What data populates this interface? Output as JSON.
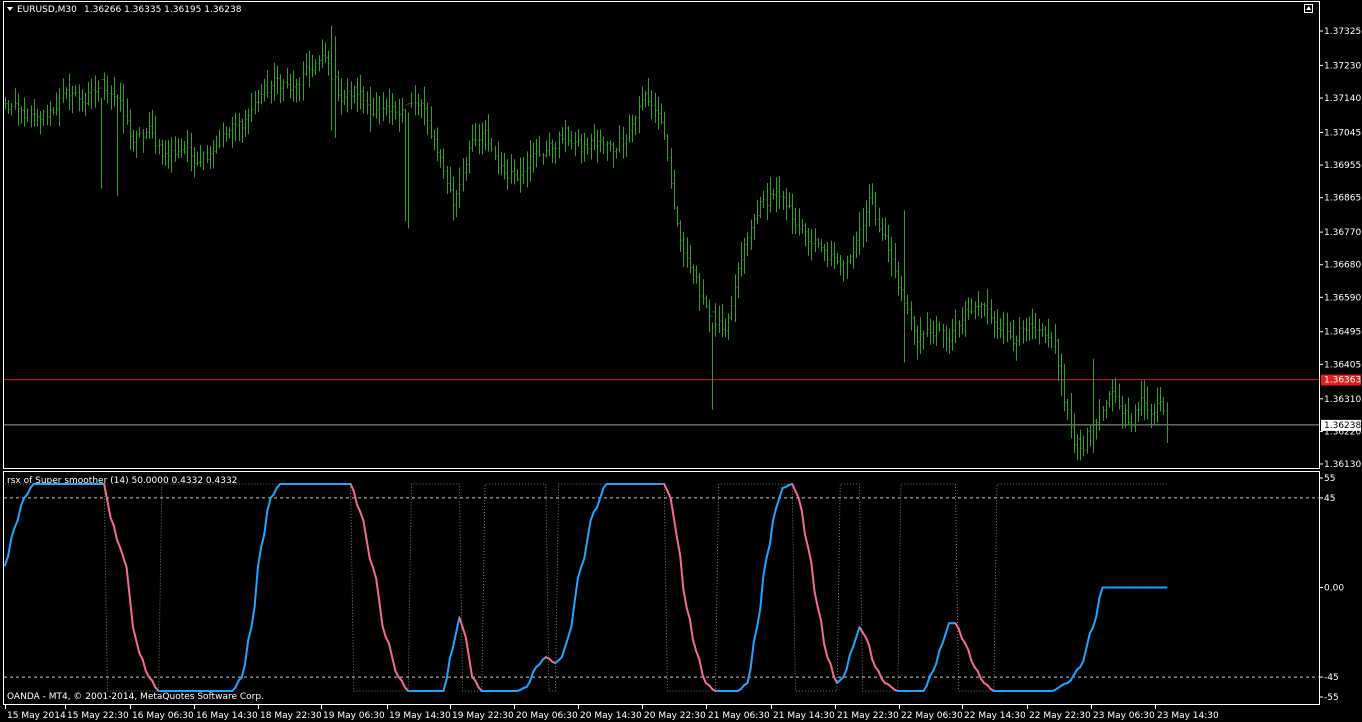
{
  "symbol_header": {
    "symbol": "EURUSD,M30",
    "ohlc": "1.36266 1.36335 1.36195 1.36238"
  },
  "indicator_header": "rsx of Super smoother (14) 50.0000 0.4332 0.4332",
  "copyright": "OANDA - MT4, © 2001-2014, MetaQuotes Software Corp.",
  "colors": {
    "background": "#000000",
    "bars": "#2fa024",
    "rsx_up": "#1ea5ff",
    "rsx_down": "#f06e87",
    "red_line": "#e01919",
    "grey_line": "#a0a0a0",
    "level_line": "#c8c8c8",
    "red_badge": "#e02020"
  },
  "chart_data": [
    {
      "type": "bar",
      "title": "EURUSD,M30",
      "ylim": [
        1.3612,
        1.3737
      ],
      "y_ticks": [
        "1.37325",
        "1.37230",
        "1.37140",
        "1.37045",
        "1.36955",
        "1.36865",
        "1.36770",
        "1.36680",
        "1.36590",
        "1.36495",
        "1.36405",
        "1.36310",
        "1.36220",
        "1.36130"
      ],
      "x_ticks": [
        "15 May 2014",
        "15 May 22:30",
        "16 May 06:30",
        "16 May 14:30",
        "18 May 22:30",
        "19 May 06:30",
        "19 May 14:30",
        "19 May 22:30",
        "20 May 06:30",
        "20 May 14:30",
        "20 May 22:30",
        "21 May 06:30",
        "21 May 14:30",
        "21 May 22:30",
        "22 May 06:30",
        "22 May 14:30",
        "22 May 22:30",
        "23 May 06:30",
        "23 May 14:30"
      ],
      "red_line_level": "1.36363",
      "bid_level": "1.36238",
      "close_anchors": [
        [
          0,
          1.3712
        ],
        [
          5,
          1.371
        ],
        [
          10,
          1.3708
        ],
        [
          15,
          1.3711
        ],
        [
          20,
          1.3716
        ],
        [
          25,
          1.3713
        ],
        [
          30,
          1.3718
        ],
        [
          35,
          1.3714
        ],
        [
          40,
          1.3702
        ],
        [
          45,
          1.3705
        ],
        [
          50,
          1.3698
        ],
        [
          55,
          1.37
        ],
        [
          60,
          1.3697
        ],
        [
          65,
          1.37
        ],
        [
          70,
          1.3705
        ],
        [
          75,
          1.3708
        ],
        [
          80,
          1.3715
        ],
        [
          85,
          1.3719
        ],
        [
          90,
          1.3716
        ],
        [
          95,
          1.3722
        ],
        [
          100,
          1.3725
        ],
        [
          105,
          1.3714
        ],
        [
          110,
          1.3716
        ],
        [
          115,
          1.371
        ],
        [
          120,
          1.371
        ],
        [
          125,
          1.3712
        ],
        [
          130,
          1.3712
        ],
        [
          135,
          1.37
        ],
        [
          140,
          1.3685
        ],
        [
          145,
          1.37
        ],
        [
          150,
          1.3704
        ],
        [
          155,
          1.3694
        ],
        [
          160,
          1.3693
        ],
        [
          165,
          1.3698
        ],
        [
          170,
          1.37
        ],
        [
          175,
          1.3704
        ],
        [
          180,
          1.37
        ],
        [
          185,
          1.3702
        ],
        [
          190,
          1.37
        ],
        [
          195,
          1.3705
        ],
        [
          200,
          1.3715
        ],
        [
          205,
          1.3708
        ],
        [
          210,
          1.3678
        ],
        [
          215,
          1.3665
        ],
        [
          220,
          1.3655
        ],
        [
          225,
          1.3648
        ],
        [
          230,
          1.367
        ],
        [
          235,
          1.3683
        ],
        [
          240,
          1.3688
        ],
        [
          245,
          1.3683
        ],
        [
          250,
          1.3676
        ],
        [
          255,
          1.3672
        ],
        [
          260,
          1.3668
        ],
        [
          265,
          1.3672
        ],
        [
          270,
          1.3686
        ],
        [
          275,
          1.3675
        ],
        [
          280,
          1.366
        ],
        [
          285,
          1.3648
        ],
        [
          290,
          1.365
        ],
        [
          295,
          1.3648
        ],
        [
          300,
          1.3654
        ],
        [
          305,
          1.3657
        ],
        [
          310,
          1.3652
        ],
        [
          315,
          1.3648
        ],
        [
          320,
          1.365
        ],
        [
          325,
          1.3648
        ],
        [
          328,
          1.3646
        ],
        [
          331,
          1.363
        ],
        [
          334,
          1.362
        ],
        [
          337,
          1.3618
        ],
        [
          340,
          1.3625
        ],
        [
          343,
          1.3628
        ],
        [
          346,
          1.3632
        ],
        [
          349,
          1.3628
        ],
        [
          352,
          1.3625
        ],
        [
          355,
          1.363
        ],
        [
          358,
          1.3628
        ],
        [
          361,
          1.363
        ],
        [
          363,
          1.3624
        ]
      ],
      "spikes": [
        [
          30,
          1.3689,
          1.3714
        ],
        [
          35,
          1.3687,
          1.3715
        ],
        [
          102,
          1.3705,
          1.3734
        ],
        [
          103,
          1.3703,
          1.3731
        ],
        [
          125,
          1.368,
          1.3711
        ],
        [
          126,
          1.3678,
          1.371
        ],
        [
          221,
          1.3628,
          1.3652
        ],
        [
          281,
          1.3641,
          1.3683
        ],
        [
          340,
          1.3616,
          1.3642
        ]
      ]
    },
    {
      "type": "line",
      "title": "rsx of Super smoother (14) 50.0000 0.4332 0.4332",
      "ylim": [
        -55,
        55
      ],
      "y_ticks": [
        "55",
        "45",
        "0.00",
        "-45",
        "-55"
      ],
      "levels": [
        45,
        -45
      ],
      "rsx_anchors": [
        [
          0,
          11
        ],
        [
          3,
          30
        ],
        [
          6,
          45
        ],
        [
          9,
          52
        ],
        [
          15,
          52
        ],
        [
          31,
          52
        ],
        [
          33,
          35
        ],
        [
          36,
          20
        ],
        [
          38,
          10
        ],
        [
          40,
          -20
        ],
        [
          42,
          -33
        ],
        [
          45,
          -45
        ],
        [
          48,
          -52
        ],
        [
          54,
          -52
        ],
        [
          71,
          -52
        ],
        [
          74,
          -45
        ],
        [
          77,
          -20
        ],
        [
          80,
          20
        ],
        [
          83,
          45
        ],
        [
          86,
          52
        ],
        [
          108,
          52
        ],
        [
          111,
          38
        ],
        [
          115,
          10
        ],
        [
          119,
          -25
        ],
        [
          123,
          -45
        ],
        [
          126,
          -52
        ],
        [
          137,
          -52
        ],
        [
          140,
          -30
        ],
        [
          142,
          -15
        ],
        [
          144,
          -25
        ],
        [
          146,
          -45
        ],
        [
          149,
          -52
        ],
        [
          160,
          -52
        ],
        [
          163,
          -50
        ],
        [
          166,
          -40
        ],
        [
          169,
          -35
        ],
        [
          172,
          -38
        ],
        [
          174,
          -35
        ],
        [
          176,
          -25
        ],
        [
          180,
          10
        ],
        [
          184,
          38
        ],
        [
          188,
          52
        ],
        [
          206,
          52
        ],
        [
          208,
          45
        ],
        [
          210,
          25
        ],
        [
          213,
          -10
        ],
        [
          216,
          -32
        ],
        [
          219,
          -48
        ],
        [
          222,
          -52
        ],
        [
          229,
          -52
        ],
        [
          232,
          -48
        ],
        [
          235,
          -20
        ],
        [
          238,
          15
        ],
        [
          241,
          40
        ],
        [
          243,
          50
        ],
        [
          246,
          52
        ],
        [
          248,
          45
        ],
        [
          251,
          20
        ],
        [
          254,
          -10
        ],
        [
          257,
          -35
        ],
        [
          260,
          -48
        ],
        [
          262,
          -45
        ],
        [
          265,
          -30
        ],
        [
          267,
          -20
        ],
        [
          269,
          -25
        ],
        [
          272,
          -40
        ],
        [
          275,
          -48
        ],
        [
          279,
          -52
        ],
        [
          287,
          -52
        ],
        [
          290,
          -42
        ],
        [
          293,
          -28
        ],
        [
          295,
          -18
        ],
        [
          297,
          -18
        ],
        [
          300,
          -28
        ],
        [
          303,
          -40
        ],
        [
          306,
          -48
        ],
        [
          309,
          -52
        ],
        [
          327,
          -52
        ],
        [
          332,
          -48
        ],
        [
          336,
          -40
        ],
        [
          340,
          -20
        ],
        [
          343,
          0
        ]
      ]
    }
  ]
}
